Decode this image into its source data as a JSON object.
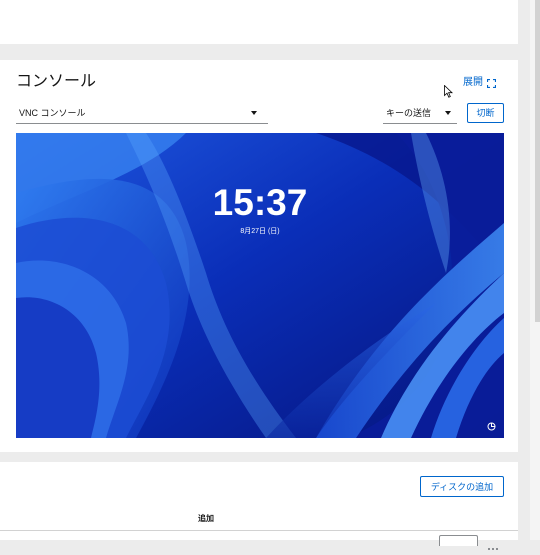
{
  "console": {
    "title": "コンソール",
    "expand_label": "展開",
    "type_select": {
      "selected": "VNC コンソール"
    },
    "keys_select": {
      "selected": "キーの送信"
    },
    "disconnect_label": "切断",
    "screen": {
      "time": "15:37",
      "date": "8月27日 (日)"
    }
  },
  "disks": {
    "add_disk_label": "ディスクの追加",
    "column_header": "追加"
  },
  "colors": {
    "accent": "#0066cc",
    "page_background": "#ececec",
    "wallpaper_blue": "#0b2aa8"
  }
}
